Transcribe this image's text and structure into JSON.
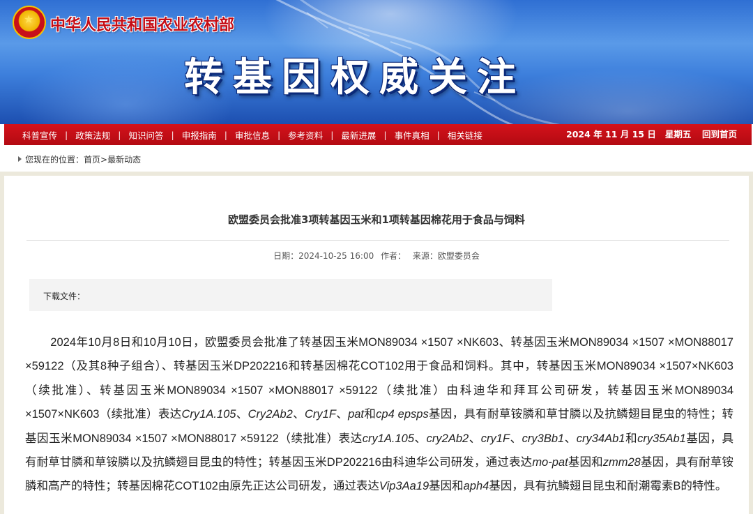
{
  "header": {
    "ministry_name": "中华人民共和国农业农村部",
    "site_title": "转基因权威关注"
  },
  "nav": {
    "items": [
      "科普宣传",
      "政策法规",
      "知识问答",
      "申报指南",
      "审批信息",
      "参考资料",
      "最新进展",
      "事件真相",
      "相关链接"
    ],
    "date": "2024 年 11 月 15 日   星期五",
    "home_link": "回到首页"
  },
  "breadcrumb": {
    "prefix": "您现在的位置：",
    "home": "首页",
    "separator": ">",
    "current": "最新动态"
  },
  "article": {
    "title": "欧盟委员会批准3项转基因玉米和1项转基因棉花用于食品与饲料",
    "meta": {
      "date": "日期：2024-10-25 16:00",
      "author": "作者：",
      "source": "来源：欧盟委员会"
    },
    "download_label": "下载文件：",
    "body": [
      {
        "t": "2024年10月8日和10月10日，欧盟委员会批准了转基因玉米MON89034 ×1507 ×NK603、转基因玉米MON89034 ×1507 ×MON88017 ×59122（及其8种子组合）、转基因玉米DP202216和转基因棉花COT102用于食品和饲料。其中，转基因玉米MON89034 ×1507×NK603（续批准）、转基因玉米MON89034 ×1507 ×MON88017 ×59122（续批准）由科迪华和拜耳公司研发，转基因玉米MON89034 ×1507×NK603（续批准）表达"
      },
      {
        "t": "Cry1A.105",
        "i": true
      },
      {
        "t": "、"
      },
      {
        "t": "Cry2Ab2",
        "i": true
      },
      {
        "t": "、"
      },
      {
        "t": "Cry1F",
        "i": true
      },
      {
        "t": "、"
      },
      {
        "t": "pat",
        "i": true
      },
      {
        "t": "和"
      },
      {
        "t": "cp4 epsps",
        "i": true
      },
      {
        "t": "基因，具有耐草铵膦和草甘膦以及抗鳞翅目昆虫的特性；转基因玉米MON89034 ×1507 ×MON88017 ×59122（续批准）表达"
      },
      {
        "t": "cry1A.105",
        "i": true
      },
      {
        "t": "、"
      },
      {
        "t": "cry2Ab2",
        "i": true
      },
      {
        "t": "、"
      },
      {
        "t": "cry1F",
        "i": true
      },
      {
        "t": "、"
      },
      {
        "t": "cry3Bb1",
        "i": true
      },
      {
        "t": "、"
      },
      {
        "t": "cry34Ab1",
        "i": true
      },
      {
        "t": "和"
      },
      {
        "t": "cry35Ab1",
        "i": true
      },
      {
        "t": "基因，具有耐草甘膦和草铵膦以及抗鳞翅目昆虫的特性；转基因玉米DP202216由科迪华公司研发，通过表达"
      },
      {
        "t": "mo-pat",
        "i": true
      },
      {
        "t": "基因和"
      },
      {
        "t": "zmm28",
        "i": true
      },
      {
        "t": "基因，具有耐草铵膦和高产的特性；转基因棉花COT102由原先正达公司研发，通过表达"
      },
      {
        "t": "Vip3Aa19",
        "i": true
      },
      {
        "t": "基因和"
      },
      {
        "t": "aph4",
        "i": true
      },
      {
        "t": "基因，具有抗鳞翅目昆虫和耐潮霉素B的特性。"
      }
    ]
  }
}
